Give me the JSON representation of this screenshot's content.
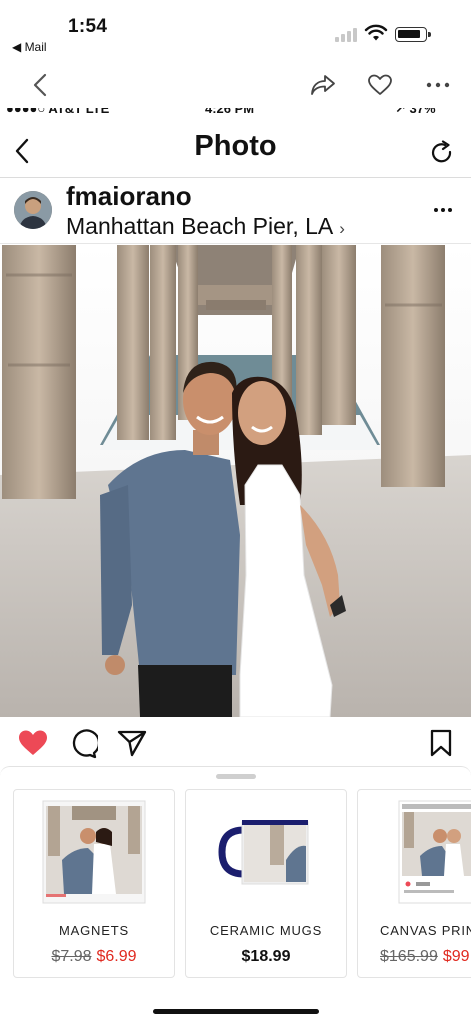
{
  "status_bar": {
    "time": "1:54",
    "back_app": "◀ Mail"
  },
  "embedded": {
    "status_bar": {
      "carrier": "●●●●○ AT&T  LTE",
      "time": "4:26 PM",
      "battery": "↗ 37%"
    },
    "nav": {
      "title": "Photo"
    },
    "post": {
      "username": "fmaiorano",
      "location": "Manhattan Beach Pier, LA"
    }
  },
  "products": [
    {
      "name": "MAGNETS",
      "old_price": "$7.98",
      "price": "$6.99"
    },
    {
      "name": "CERAMIC MUGS",
      "price": "$18.99"
    },
    {
      "name": "CANVAS PRINTS",
      "old_price": "$165.99",
      "price": "$99"
    }
  ],
  "colors": {
    "like": "#ed4956",
    "sale": "#e0291f",
    "mug_handle": "#1b1e6e"
  }
}
